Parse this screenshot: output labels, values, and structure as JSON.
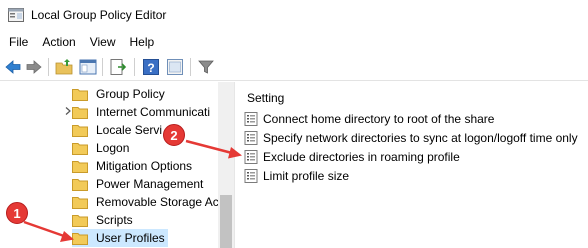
{
  "window": {
    "title": "Local Group Policy Editor"
  },
  "menu": [
    {
      "label": "File"
    },
    {
      "label": "Action"
    },
    {
      "label": "View"
    },
    {
      "label": "Help"
    }
  ],
  "toolbar": {
    "buttons": [
      "back-icon",
      "forward-icon",
      "up-folder-icon",
      "show-hide-tree-icon",
      "export-list-icon",
      "help-icon",
      "properties-icon",
      "filter-icon"
    ]
  },
  "tree": {
    "items": [
      {
        "label": "Group Policy",
        "selected": false,
        "expandable": false
      },
      {
        "label": "Internet Communicati",
        "selected": false,
        "expandable": true
      },
      {
        "label": "Locale Servi",
        "selected": false,
        "expandable": false
      },
      {
        "label": "Logon",
        "selected": false,
        "expandable": false
      },
      {
        "label": "Mitigation Options",
        "selected": false,
        "expandable": false
      },
      {
        "label": "Power Management",
        "selected": false,
        "expandable": false
      },
      {
        "label": "Removable Storage Ac",
        "selected": false,
        "expandable": false
      },
      {
        "label": "Scripts",
        "selected": false,
        "expandable": false
      },
      {
        "label": "User Profiles",
        "selected": true,
        "expandable": false
      }
    ]
  },
  "settings": {
    "column_header": "Setting",
    "rows": [
      {
        "label": "Connect home directory to root of the share"
      },
      {
        "label": "Specify network directories to sync at logon/logoff time only"
      },
      {
        "label": "Exclude directories in roaming profile"
      },
      {
        "label": "Limit profile size"
      }
    ]
  },
  "annotations": {
    "badge1": "1",
    "badge2": "2",
    "color": "#e53935"
  }
}
